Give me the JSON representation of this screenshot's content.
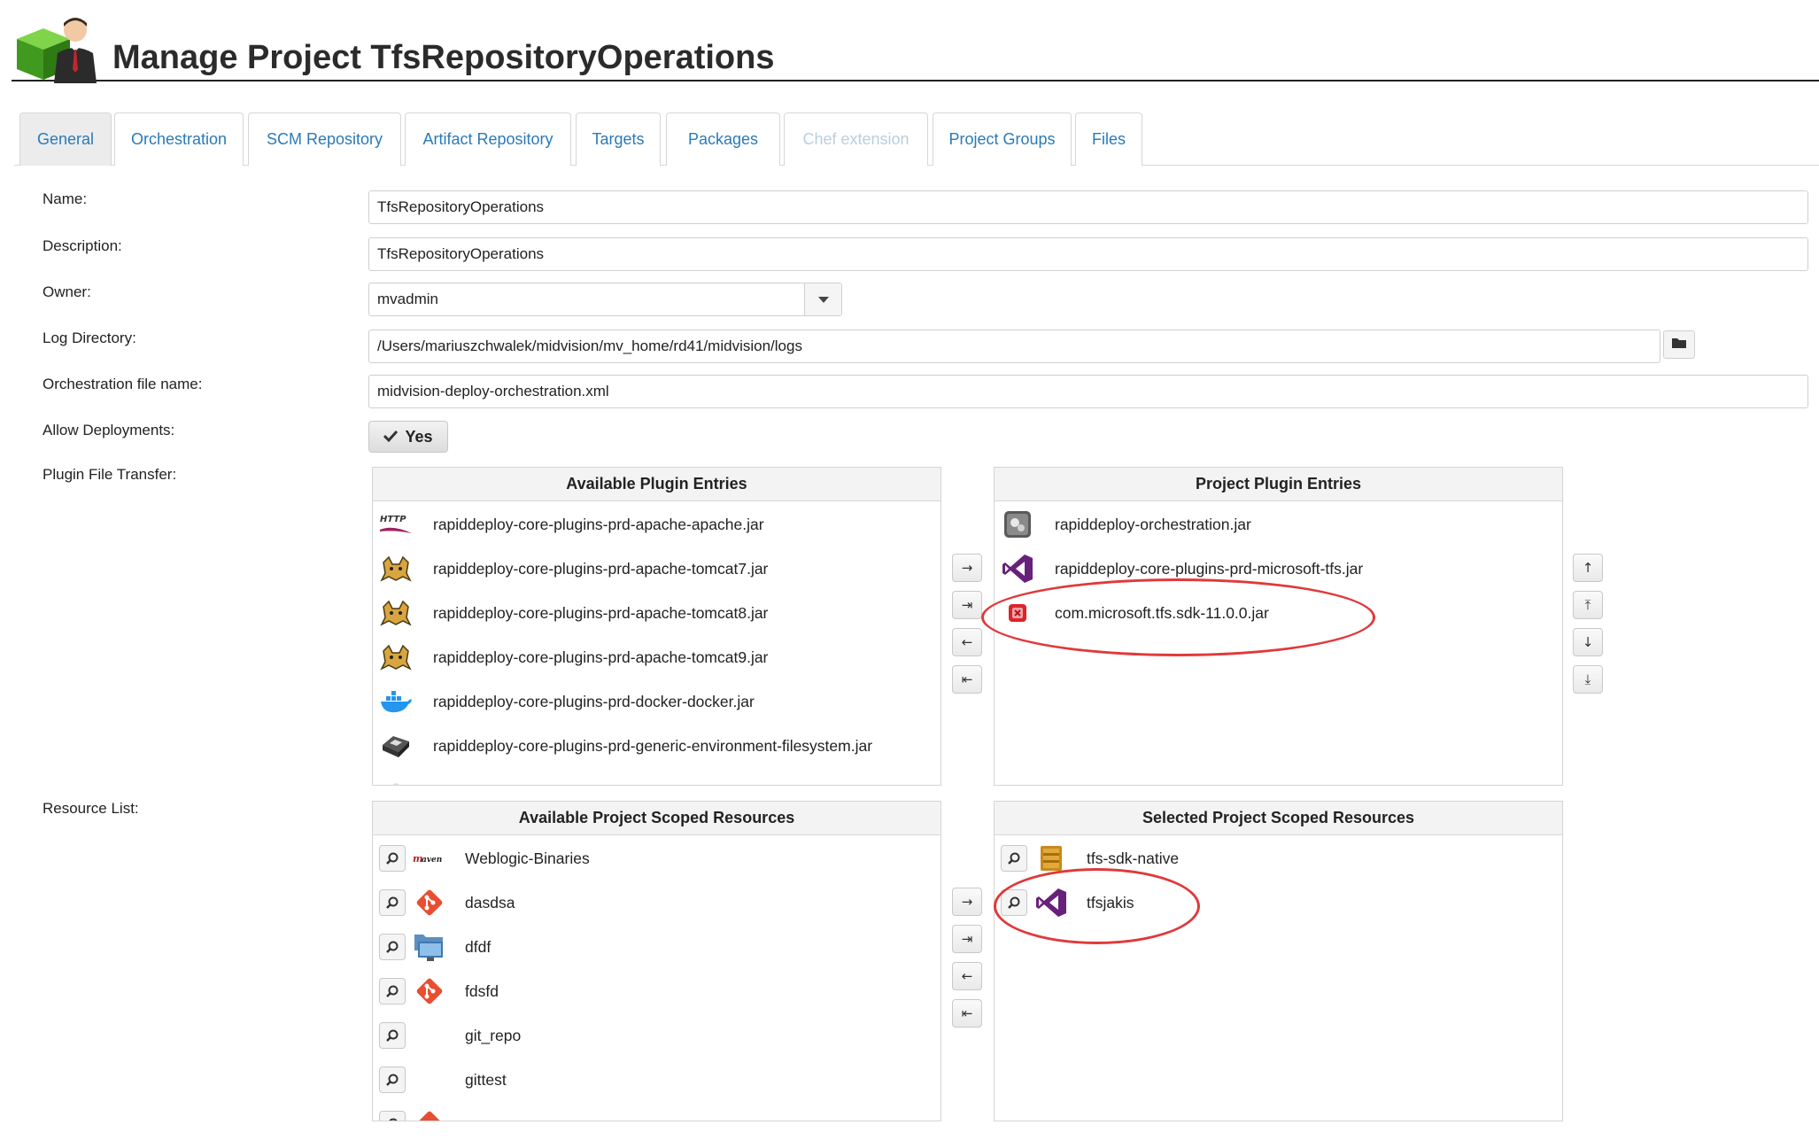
{
  "header": {
    "title": "Manage Project TfsRepositoryOperations"
  },
  "tabs": [
    {
      "label": "General",
      "state": "active"
    },
    {
      "label": "Orchestration",
      "state": "normal"
    },
    {
      "label": "SCM Repository",
      "state": "normal"
    },
    {
      "label": "Artifact Repository",
      "state": "normal"
    },
    {
      "label": "Targets",
      "state": "normal"
    },
    {
      "label": "Packages",
      "state": "normal"
    },
    {
      "label": "Chef extension",
      "state": "disabled"
    },
    {
      "label": "Project Groups",
      "state": "normal"
    },
    {
      "label": "Files",
      "state": "normal"
    }
  ],
  "form": {
    "name_label": "Name:",
    "name_value": "TfsRepositoryOperations",
    "description_label": "Description:",
    "description_value": "TfsRepositoryOperations",
    "owner_label": "Owner:",
    "owner_value": "mvadmin",
    "logdir_label": "Log Directory:",
    "logdir_value": "/Users/mariuszchwalek/midvision/mv_home/rd41/midvision/logs",
    "orchfile_label": "Orchestration file name:",
    "orchfile_value": "midvision-deploy-orchestration.xml",
    "allow_label": "Allow Deployments:",
    "allow_value": "Yes",
    "plugin_label": "Plugin File Transfer:",
    "resource_label": "Resource List:"
  },
  "available_plugins": {
    "title": "Available Plugin Entries",
    "items": [
      {
        "label": "rapiddeploy-core-plugins-prd-apache-apache.jar",
        "icon": "http-icon"
      },
      {
        "label": "rapiddeploy-core-plugins-prd-apache-tomcat7.jar",
        "icon": "tomcat-icon"
      },
      {
        "label": "rapiddeploy-core-plugins-prd-apache-tomcat8.jar",
        "icon": "tomcat-icon"
      },
      {
        "label": "rapiddeploy-core-plugins-prd-apache-tomcat9.jar",
        "icon": "tomcat-icon"
      },
      {
        "label": "rapiddeploy-core-plugins-prd-docker-docker.jar",
        "icon": "docker-icon"
      },
      {
        "label": "rapiddeploy-core-plugins-prd-generic-environment-filesystem.jar",
        "icon": "filesystem-icon"
      }
    ]
  },
  "project_plugins": {
    "title": "Project Plugin Entries",
    "items": [
      {
        "label": "rapiddeploy-orchestration.jar",
        "icon": "orchestration-icon"
      },
      {
        "label": "rapiddeploy-core-plugins-prd-microsoft-tfs.jar",
        "icon": "visual-studio-icon"
      },
      {
        "label": "com.microsoft.tfs.sdk-11.0.0.jar",
        "icon": "error-icon"
      }
    ]
  },
  "available_resources": {
    "title": "Available Project Scoped Resources",
    "items": [
      {
        "label": "Weblogic-Binaries",
        "icon": "maven-icon"
      },
      {
        "label": "dasdsa",
        "icon": "git-icon"
      },
      {
        "label": "dfdf",
        "icon": "folder-monitor-icon"
      },
      {
        "label": "fdsfd",
        "icon": "git-icon"
      },
      {
        "label": "git_repo",
        "icon": ""
      },
      {
        "label": "gittest",
        "icon": ""
      }
    ]
  },
  "selected_resources": {
    "title": "Selected Project Scoped Resources",
    "items": [
      {
        "label": "tfs-sdk-native",
        "icon": "archive-icon"
      },
      {
        "label": "tfsjakis",
        "icon": "visual-studio-icon"
      }
    ]
  },
  "transfer_buttons": {
    "move_right": "→",
    "move_all_right": "⇥",
    "move_left": "←",
    "move_all_left": "⇤"
  },
  "order_buttons": {
    "up": "↑",
    "top": "⤒",
    "down": "↓",
    "bottom": "⤓"
  },
  "colors": {
    "link": "#2a7ab8",
    "highlight_ellipse": "#e0393a",
    "git": "#e84e31",
    "visual_studio": "#68217a"
  }
}
